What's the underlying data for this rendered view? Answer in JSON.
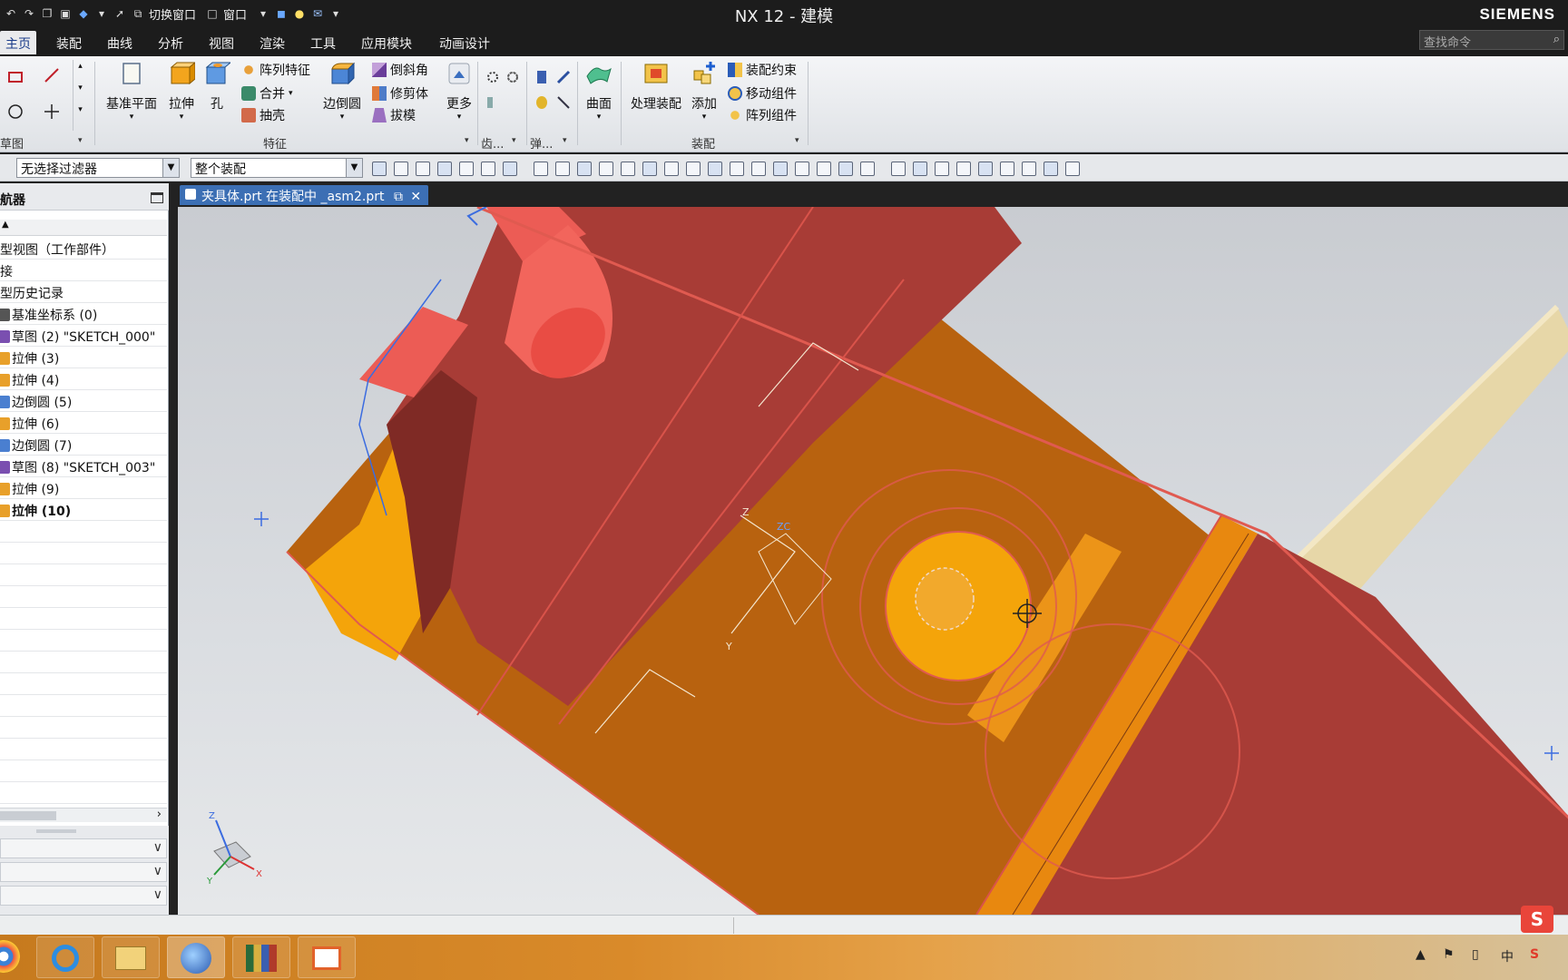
{
  "window": {
    "title": "NX 12 - 建模",
    "brand": "SIEMENS",
    "qat_switch_window": "切换窗口",
    "qat_window": "窗口"
  },
  "menu": {
    "tabs": [
      "主页",
      "装配",
      "曲线",
      "分析",
      "视图",
      "渲染",
      "工具",
      "应用模块",
      "动画设计"
    ],
    "active": "主页",
    "search_placeholder": "查找命令"
  },
  "ribbon": {
    "sketch_group": "草图",
    "feature_group": "特征",
    "assembly_group": "装配",
    "gear_group": "齿...",
    "spring_group": "弹...",
    "datum_plane": "基准平面",
    "extrude": "拉伸",
    "hole": "孔",
    "pattern_feature": "阵列特征",
    "unite": "合并",
    "shell": "抽壳",
    "edge_blend": "边倒圆",
    "chamfer": "倒斜角",
    "trim_body": "修剪体",
    "draft": "拔模",
    "more": "更多",
    "surface": "曲面",
    "process_assembly": "处理装配",
    "add": "添加",
    "assembly_constraints": "装配约束",
    "move_component": "移动组件",
    "pattern_component": "阵列组件"
  },
  "filterbar": {
    "type_filter": "无选择过滤器",
    "scope": "整个装配"
  },
  "navigator": {
    "title": "航器",
    "rows": [
      {
        "label": "型视图（工作部件）",
        "icon": "none",
        "bold": false
      },
      {
        "label": "接",
        "icon": "none",
        "bold": false
      },
      {
        "label": "型历史记录",
        "icon": "none",
        "bold": false
      },
      {
        "label": "基准坐标系 (0)",
        "icon": "datum-csys-icon",
        "bold": false
      },
      {
        "label": "草图 (2) \"SKETCH_000\"",
        "icon": "sketch-icon",
        "bold": false
      },
      {
        "label": "拉伸 (3)",
        "icon": "extrude-icon",
        "bold": false
      },
      {
        "label": "拉伸 (4)",
        "icon": "extrude-icon",
        "bold": false
      },
      {
        "label": "边倒圆 (5)",
        "icon": "edge-blend-icon",
        "bold": false
      },
      {
        "label": "拉伸 (6)",
        "icon": "extrude-icon",
        "bold": false
      },
      {
        "label": "边倒圆 (7)",
        "icon": "edge-blend-icon",
        "bold": false
      },
      {
        "label": "草图 (8) \"SKETCH_003\"",
        "icon": "sketch-icon",
        "bold": false
      },
      {
        "label": "拉伸 (9)",
        "icon": "extrude-icon",
        "bold": false
      },
      {
        "label": "拉伸 (10)",
        "icon": "extrude-icon",
        "bold": true
      }
    ]
  },
  "document_tab": {
    "label": "夹具体.prt 在装配中 _asm2.prt"
  },
  "viewport": {
    "triad_labels": {
      "x": "X",
      "y": "Y",
      "z": "Z"
    },
    "csys_labels": {
      "z": "Z",
      "zc": "ZC",
      "y": "Y"
    }
  },
  "colors": {
    "part_red": "#a83c36",
    "part_orange": "#b8620f",
    "part_amber": "#f4a40a",
    "pin_cream": "#e7d7a8",
    "edge_highlight": "#e05a50",
    "tab_blue": "#3c6fb4"
  }
}
